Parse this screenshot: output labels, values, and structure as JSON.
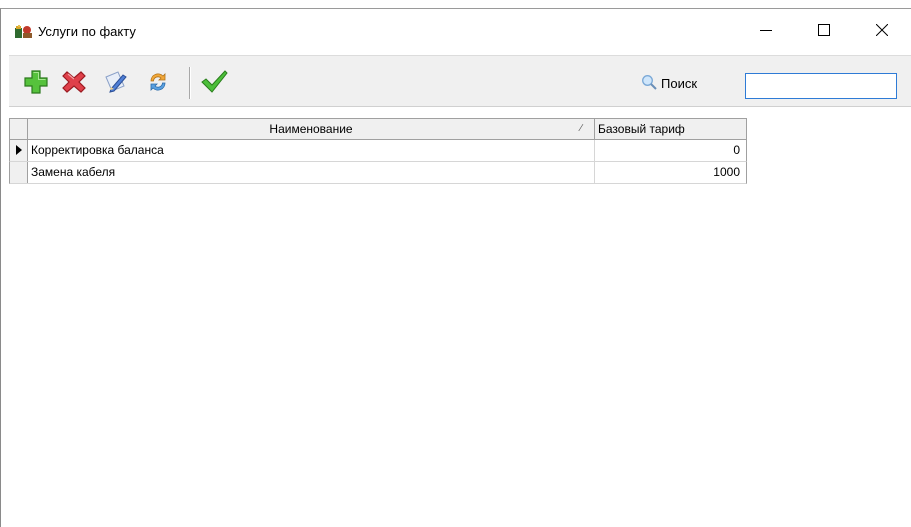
{
  "window": {
    "title": "Услуги по факту",
    "app_icon": "services-app-icon",
    "controls": {
      "minimize": "minimize-icon",
      "maximize": "maximize-icon",
      "close": "close-icon"
    }
  },
  "toolbar": {
    "buttons": [
      {
        "icon": "add-plus-icon",
        "color": "#3fae2a"
      },
      {
        "icon": "delete-x-icon",
        "color": "#d9303a"
      },
      {
        "icon": "edit-pencil-icon",
        "color": "#4a7bd0"
      },
      {
        "icon": "refresh-arrows-icon",
        "color": "#f0a020"
      },
      {
        "icon": "apply-check-icon",
        "color": "#3fae2a"
      }
    ],
    "search_label": "Поиск",
    "search_value": ""
  },
  "grid": {
    "columns": {
      "name": "Наименование",
      "tariff": "Базовый тариф"
    },
    "rows": [
      {
        "name": "Корректировка баланса",
        "tariff": "0",
        "current": true
      },
      {
        "name": "Замена кабеля",
        "tariff": "1000",
        "current": false
      }
    ]
  }
}
